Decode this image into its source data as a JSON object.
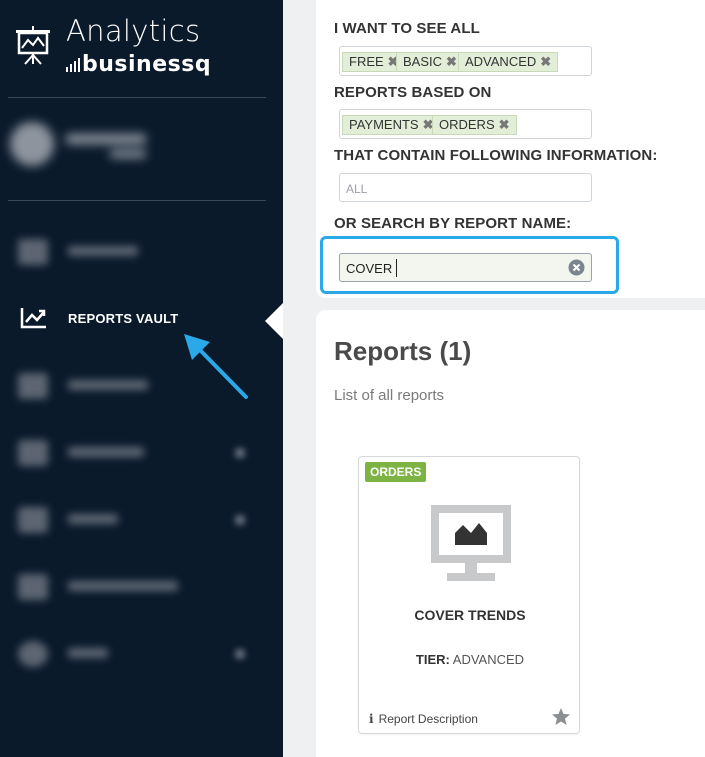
{
  "brand": {
    "title": "Analytics",
    "subtitle": "businessq"
  },
  "sidebar": {
    "active_item": {
      "label": "REPORTS VAULT",
      "icon": "chart-line-icon"
    }
  },
  "filters": {
    "see_all_label": "I WANT TO SEE ALL",
    "tiers": [
      {
        "label": "FREE"
      },
      {
        "label": "BASIC"
      },
      {
        "label": "ADVANCED"
      }
    ],
    "based_on_label": "REPORTS BASED ON",
    "sources": [
      {
        "label": "PAYMENTS"
      },
      {
        "label": "ORDERS"
      }
    ],
    "contain_label": "THAT CONTAIN FOLLOWING INFORMATION:",
    "contain_placeholder": "ALL",
    "search_label": "OR SEARCH BY REPORT NAME:",
    "search_value": "COVER",
    "tag_remove_glyph": "✖"
  },
  "reports": {
    "title": "Reports (1)",
    "subtitle": "List of all reports",
    "items": [
      {
        "badge": "ORDERS",
        "badge_color": "#7cb342",
        "name": "COVER TRENDS",
        "tier_label": "TIER:",
        "tier_value": "ADVANCED",
        "description_link": "Report Description"
      }
    ]
  },
  "colors": {
    "sidebar_bg": "#0b1a2b",
    "accent_blue": "#2aa8e8",
    "tag_bg": "#e3eed8"
  }
}
